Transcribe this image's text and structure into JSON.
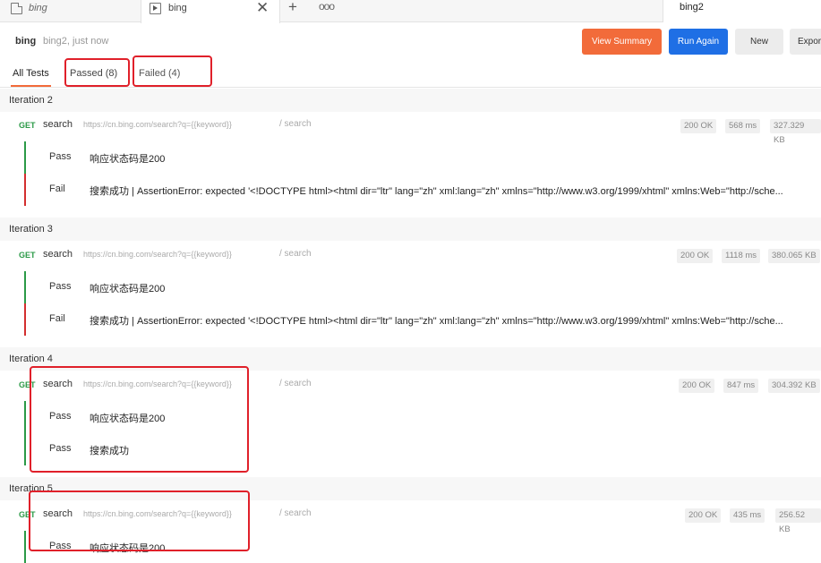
{
  "tabs": {
    "tab1_label": "bing",
    "tab2_label": "bing",
    "close_glyph": "✕",
    "add_glyph": "+",
    "more_glyph": "ooo",
    "right_tab_label": "bing2"
  },
  "header": {
    "collection_name": "bing",
    "subtitle": "bing2, just now",
    "buttons": {
      "view_summary": "View Summary",
      "run_again": "Run Again",
      "new": "New",
      "export": "Expor"
    }
  },
  "filters": {
    "all": "All Tests",
    "passed": "Passed (8)",
    "failed": "Failed (4)"
  },
  "iterations": [
    {
      "label": "Iteration 2",
      "request": {
        "method": "GET",
        "name": "search",
        "url": "https://cn.bing.com/search?q={{keyword}}",
        "path": "/ search",
        "status": "200 OK",
        "time": "568 ms",
        "size": "327.329 KB"
      },
      "results": [
        {
          "state": "Pass",
          "message": "响应状态码是200"
        },
        {
          "state": "Fail",
          "message": "搜索成功 | AssertionError: expected '<!DOCTYPE html><html dir=\"ltr\" lang=\"zh\" xml:lang=\"zh\" xmlns=\"http://www.w3.org/1999/xhtml\" xmlns:Web=\"http://sche..."
        }
      ]
    },
    {
      "label": "Iteration 3",
      "request": {
        "method": "GET",
        "name": "search",
        "url": "https://cn.bing.com/search?q={{keyword}}",
        "path": "/ search",
        "status": "200 OK",
        "time": "1118 ms",
        "size": "380.065 KB"
      },
      "results": [
        {
          "state": "Pass",
          "message": "响应状态码是200"
        },
        {
          "state": "Fail",
          "message": "搜索成功 | AssertionError: expected '<!DOCTYPE html><html dir=\"ltr\" lang=\"zh\" xml:lang=\"zh\" xmlns=\"http://www.w3.org/1999/xhtml\" xmlns:Web=\"http://sche..."
        }
      ]
    },
    {
      "label": "Iteration 4",
      "request": {
        "method": "GET",
        "name": "search",
        "url": "https://cn.bing.com/search?q={{keyword}}",
        "path": "/ search",
        "status": "200 OK",
        "time": "847 ms",
        "size": "304.392 KB"
      },
      "results": [
        {
          "state": "Pass",
          "message": "响应状态码是200"
        },
        {
          "state": "Pass",
          "message": "搜索成功"
        }
      ]
    },
    {
      "label": "Iteration 5",
      "request": {
        "method": "GET",
        "name": "search",
        "url": "https://cn.bing.com/search?q={{keyword}}",
        "path": "/ search",
        "status": "200 OK",
        "time": "435 ms",
        "size": "256.52 KB"
      },
      "results": [
        {
          "state": "Pass",
          "message": "响应状态码是200"
        }
      ]
    }
  ],
  "colors": {
    "accent_orange": "#f26b3a",
    "primary_blue": "#1f6fe5",
    "pass_green": "#2b9a47",
    "fail_red": "#d32f2f",
    "annotation_red": "#e0202a"
  }
}
